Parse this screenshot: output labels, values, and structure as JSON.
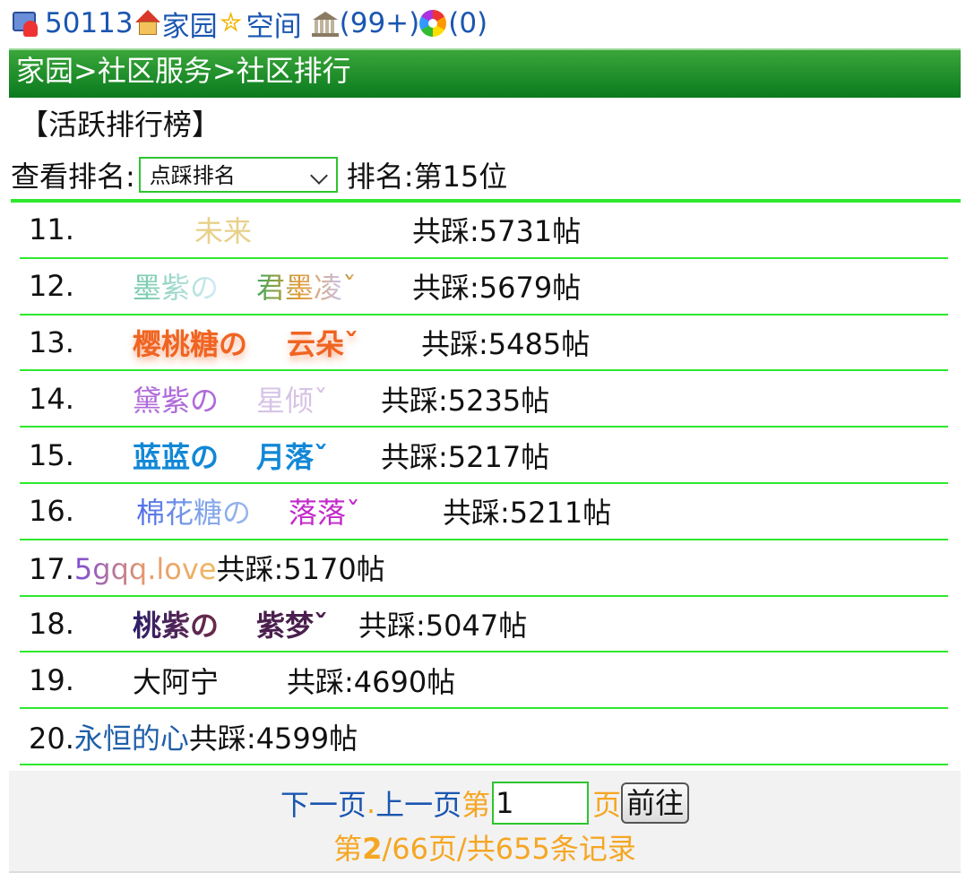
{
  "topbar": {
    "user_id": "50113",
    "home_label": "家园",
    "space_label": "空间",
    "messages": "(99+)",
    "notifications": "(0)"
  },
  "breadcrumb": "家园>社区服务>社区排行",
  "board_title": "【活跃排行榜】",
  "filter": {
    "label": "查看排名:",
    "selected": "点踩排名",
    "rank_text": "排名:第15位"
  },
  "ranking": [
    {
      "num": "11.",
      "name": "未来",
      "count": "共踩:5731帖"
    },
    {
      "num": "12.",
      "name_a": "墨紫の",
      "name_b": "君墨凌",
      "mark": "ˇ",
      "count": "共踩:5679帖"
    },
    {
      "num": "13.",
      "name_a": "樱桃糖の",
      "name_b": "云朵",
      "mark": "ˇ",
      "count": "共踩:5485帖"
    },
    {
      "num": "14.",
      "name_a": "黛紫の",
      "name_b": "星倾",
      "mark": "ˇ",
      "count": "共踩:5235帖"
    },
    {
      "num": "15.",
      "name_a": "蓝蓝の",
      "name_b": "月落",
      "mark": "ˇ",
      "count": "共踩:5217帖"
    },
    {
      "num": "16.",
      "name_a": "棉花糖の",
      "name_b": "落落",
      "mark": "ˇ",
      "count": "共踩:5211帖"
    },
    {
      "num": "17.",
      "name": "5gqq.love",
      "count": "共踩:5170帖"
    },
    {
      "num": "18.",
      "name_a": "桃紫の",
      "name_b": "紫梦",
      "mark": "ˇ",
      "count": "共踩:5047帖"
    },
    {
      "num": "19.",
      "name": "大阿宁",
      "count": "共踩:4690帖"
    },
    {
      "num": "20.",
      "name": "永恒的心",
      "count": "共踩:4599帖"
    }
  ],
  "pager": {
    "next": "下一页",
    "dot": ".",
    "prev": "上一页",
    "di": "第",
    "page_input": "1",
    "ye": "页",
    "go": "前往",
    "status_pre": "第",
    "current": "2",
    "status_post": "/66页/共655条记录"
  },
  "colors": {
    "title_bar": "#0a7a1e",
    "divider": "#2ee82e",
    "link": "#1a56b0",
    "pager_accent": "#f5a623"
  },
  "icons": [
    "user-computer-icon",
    "house-icon",
    "star-icon",
    "bank-icon",
    "pinwheel-icon"
  ]
}
